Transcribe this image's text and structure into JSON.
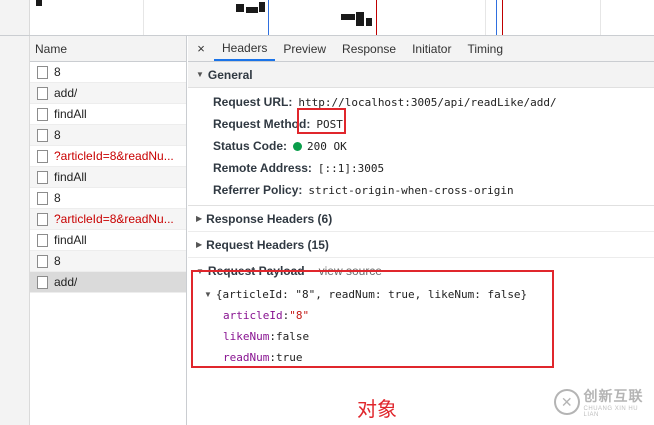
{
  "list": {
    "header": "Name",
    "items": [
      {
        "label": "8",
        "error": false
      },
      {
        "label": "add/",
        "error": false
      },
      {
        "label": "findAll",
        "error": false
      },
      {
        "label": "8",
        "error": false
      },
      {
        "label": "?articleId=8&readNu...",
        "error": true
      },
      {
        "label": "findAll",
        "error": false
      },
      {
        "label": "8",
        "error": false
      },
      {
        "label": "?articleId=8&readNu...",
        "error": true
      },
      {
        "label": "findAll",
        "error": false
      },
      {
        "label": "8",
        "error": false
      },
      {
        "label": "add/",
        "error": false,
        "selected": true
      }
    ]
  },
  "tabs": {
    "close": "×",
    "items": [
      "Headers",
      "Preview",
      "Response",
      "Initiator",
      "Timing"
    ],
    "active": "Headers"
  },
  "general": {
    "title": "General",
    "rows": [
      {
        "key": "Request URL:",
        "value": "http://localhost:3005/api/readLike/add/"
      },
      {
        "key": "Request Method:",
        "value": "POST"
      },
      {
        "key": "Status Code:",
        "value": "200  OK"
      },
      {
        "key": "Remote Address:",
        "value": "[::1]:3005"
      },
      {
        "key": "Referrer Policy:",
        "value": "strict-origin-when-cross-origin"
      }
    ]
  },
  "response_headers": {
    "title": "Response Headers (6)"
  },
  "request_headers": {
    "title": "Request Headers (15)"
  },
  "payload": {
    "title": "Request Payload",
    "view_source": "view source",
    "summary": "{articleId: \"8\", readNum: true, likeNum: false}",
    "fields": [
      {
        "key": "articleId",
        "value": "\"8\"",
        "type": "string"
      },
      {
        "key": "likeNum",
        "value": "false",
        "type": "bool"
      },
      {
        "key": "readNum",
        "value": "true",
        "type": "bool"
      }
    ]
  },
  "annotation": {
    "label": "对象"
  },
  "watermark": {
    "cn": "创新互联",
    "en": "CHUANG XIN HU LIAN",
    "symbol": "✕"
  },
  "colors": {
    "accent": "#1a73e8",
    "annotation": "#e0262c",
    "status_ok": "#0a9d4a",
    "error_text": "#c80000"
  }
}
